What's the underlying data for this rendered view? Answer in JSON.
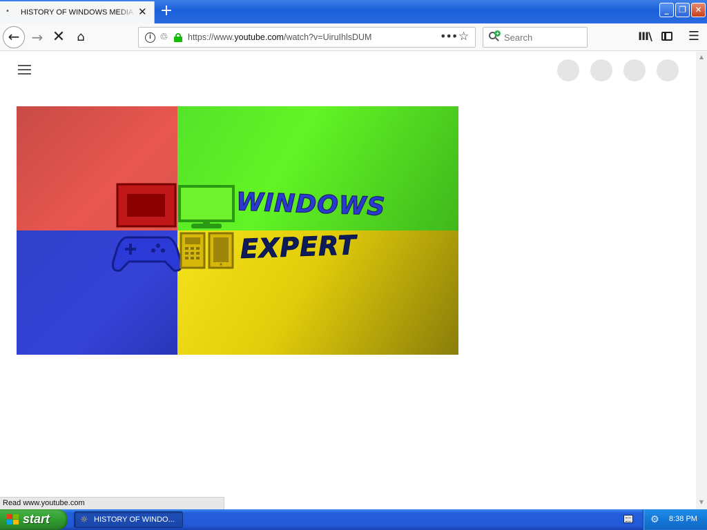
{
  "browser": {
    "tab": {
      "title": "HISTORY OF WINDOWS MEDIA PLAYER",
      "loading_glyph": "•",
      "close_glyph": "✕"
    },
    "new_tab_glyph": "+",
    "window_controls": {
      "minimize": "_",
      "maximize": "❐",
      "close": "✕"
    },
    "nav": {
      "back": "←",
      "forward": "→",
      "stop": "✕",
      "home": "⌂"
    },
    "url_bar": {
      "info_glyph": "i",
      "tracking_glyph": "♲",
      "url_prefix": "https://www.",
      "url_host": "youtube.com",
      "url_path": "/watch?v=UiruIhlsDUM",
      "more_glyph": "•••",
      "bookmark_glyph": "☆"
    },
    "search": {
      "placeholder": "Search"
    },
    "toolbar": {
      "library_glyph": "III\\",
      "menu_glyph": "☰"
    }
  },
  "page": {
    "thumbnail": {
      "word_top": "WINDOWS",
      "word_bottom": "EXPERT",
      "colors": {
        "red": "#e8574f",
        "green": "#62f425",
        "blue": "#3543d8",
        "yellow": "#e1cc0a"
      }
    },
    "status_text": "Read www.youtube.com"
  },
  "taskbar": {
    "start_label": "start",
    "task": {
      "label": "HISTORY OF WINDO...",
      "icon": "☼"
    },
    "tray_icon": "⚙",
    "clock": "8:38 PM"
  }
}
